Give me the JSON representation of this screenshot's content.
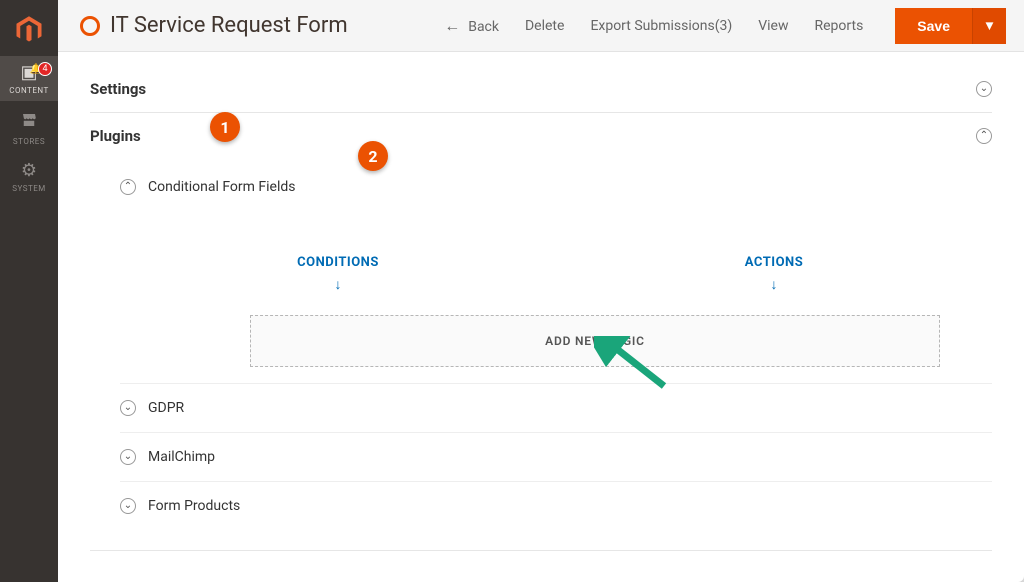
{
  "rail": {
    "items": [
      {
        "label": "CONTENT",
        "icon": "▣",
        "badge": "4"
      },
      {
        "label": "STORES",
        "icon": "⾧"
      },
      {
        "label": "SYSTEM",
        "icon": "⚙"
      }
    ]
  },
  "header": {
    "title": "IT Service Request Form",
    "actions": {
      "back": "Back",
      "delete": "Delete",
      "export": "Export Submissions(3)",
      "view": "View",
      "reports": "Reports",
      "save": "Save"
    }
  },
  "sections": {
    "settings": {
      "label": "Settings"
    },
    "plugins": {
      "label": "Plugins",
      "conditional": {
        "label": "Conditional Form Fields",
        "conditions": "CONDITIONS",
        "actions": "ACTIONS",
        "add_logic": "ADD NEW LOGIC"
      },
      "gdpr": {
        "label": "GDPR"
      },
      "mailchimp": {
        "label": "MailChimp"
      },
      "form_products": {
        "label": "Form Products"
      }
    }
  },
  "annotations": {
    "b1": "1",
    "b2": "2"
  }
}
